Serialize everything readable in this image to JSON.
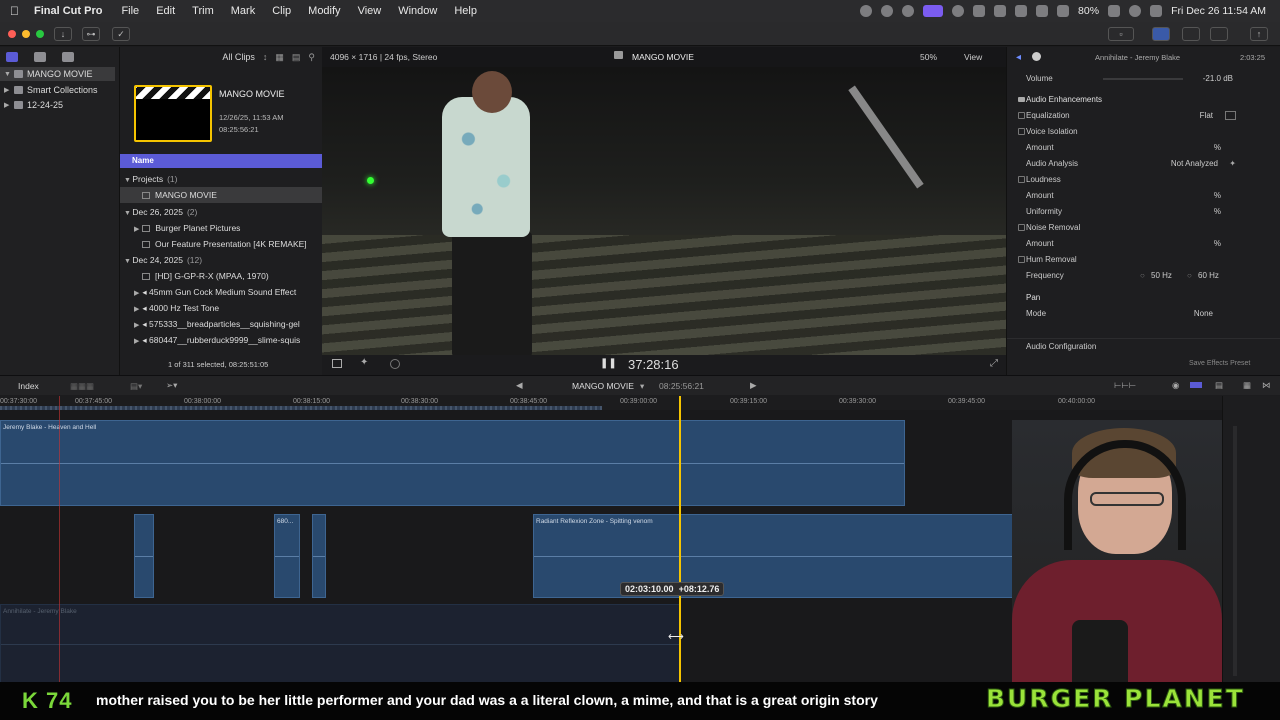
{
  "menubar": {
    "app_name": "Final Cut Pro",
    "items": [
      "File",
      "Edit",
      "Trim",
      "Mark",
      "Clip",
      "Modify",
      "View",
      "Window",
      "Help"
    ],
    "battery": "80%",
    "clock": "Fri Dec 26  11:54 AM"
  },
  "browser": {
    "filter": "All Clips",
    "project_title": "MANGO MOVIE",
    "project_date": "12/26/25, 11:53 AM",
    "project_duration": "08:25:56:21",
    "name_header": "Name",
    "footer": "1 of 311 selected, 08:25:51:05",
    "rows": [
      {
        "label": "Projects",
        "count": "(1)"
      },
      {
        "label": "MANGO MOVIE"
      },
      {
        "label": "Dec 26, 2025",
        "count": "(2)"
      },
      {
        "label": "Burger Planet Pictures"
      },
      {
        "label": "Our Feature Presentation [4K REMAKE]"
      },
      {
        "label": "Dec 24, 2025",
        "count": "(12)"
      },
      {
        "label": "[HD] G-GP-R-X (MPAA, 1970)"
      },
      {
        "label": "45mm Gun Cock Medium Sound Effect"
      },
      {
        "label": "4000 Hz Test Tone"
      },
      {
        "label": "575333__breadparticles__squishing-gel"
      },
      {
        "label": "680447__rubberduck9999__slime-squis"
      }
    ]
  },
  "sidebar": {
    "library": "MANGO MOVIE",
    "items": [
      "Smart Collections",
      "12-24-25"
    ]
  },
  "viewer": {
    "format": "4096 × 1716 | 24 fps, Stereo",
    "title": "MANGO MOVIE",
    "zoom": "50%",
    "view": "View",
    "timecode": "37:28:16"
  },
  "inspector": {
    "clip_name": "Annihilate - Jeremy Blake",
    "duration": "2:03:25",
    "volume_label": "Volume",
    "volume_value": "-21.0",
    "volume_unit": "dB",
    "audio_enhancements": "Audio Enhancements",
    "equalization": "Equalization",
    "equalization_value": "Flat",
    "voice_isolation": "Voice Isolation",
    "amount": "Amount",
    "audio_analysis": "Audio Analysis",
    "not_analyzed": "Not Analyzed",
    "loudness": "Loudness",
    "uniformity": "Uniformity",
    "noise_removal": "Noise Removal",
    "hum_removal": "Hum Removal",
    "frequency": "Frequency",
    "freq_50": "50",
    "freq_60": "60",
    "hz": "Hz",
    "percent": "%",
    "pan": "Pan",
    "mode": "Mode",
    "mode_value": "None",
    "audio_configuration": "Audio Configuration",
    "save_preset": "Save Effects Preset"
  },
  "timeline": {
    "index": "Index",
    "project": "MANGO MOVIE",
    "project_duration": "08:25:56:21",
    "ruler": [
      "00:37:30:00",
      "00:37:45:00",
      "00:38:00:00",
      "00:38:15:00",
      "00:38:30:00",
      "00:38:45:00",
      "00:39:00:00",
      "00:39:15:00",
      "00:39:30:00",
      "00:39:45:00",
      "00:40:00:00"
    ],
    "clips": {
      "main": "Jeremy Blake - Heaven and Hell",
      "small": "680...",
      "radiant": "Radiant Reflexion Zone - Spitting venom",
      "bottom": "Annihilate - Jeremy Blake"
    },
    "popup_timecode": "02:03:10.00",
    "popup_offset": "+08:12.76"
  },
  "overlay": {
    "kick_count": "74",
    "kick_letter": "K",
    "caption": "mother raised you to be her little performer and your dad was a a literal clown, a mime, and that is a great origin story",
    "brand": "BURGER PLANET"
  }
}
